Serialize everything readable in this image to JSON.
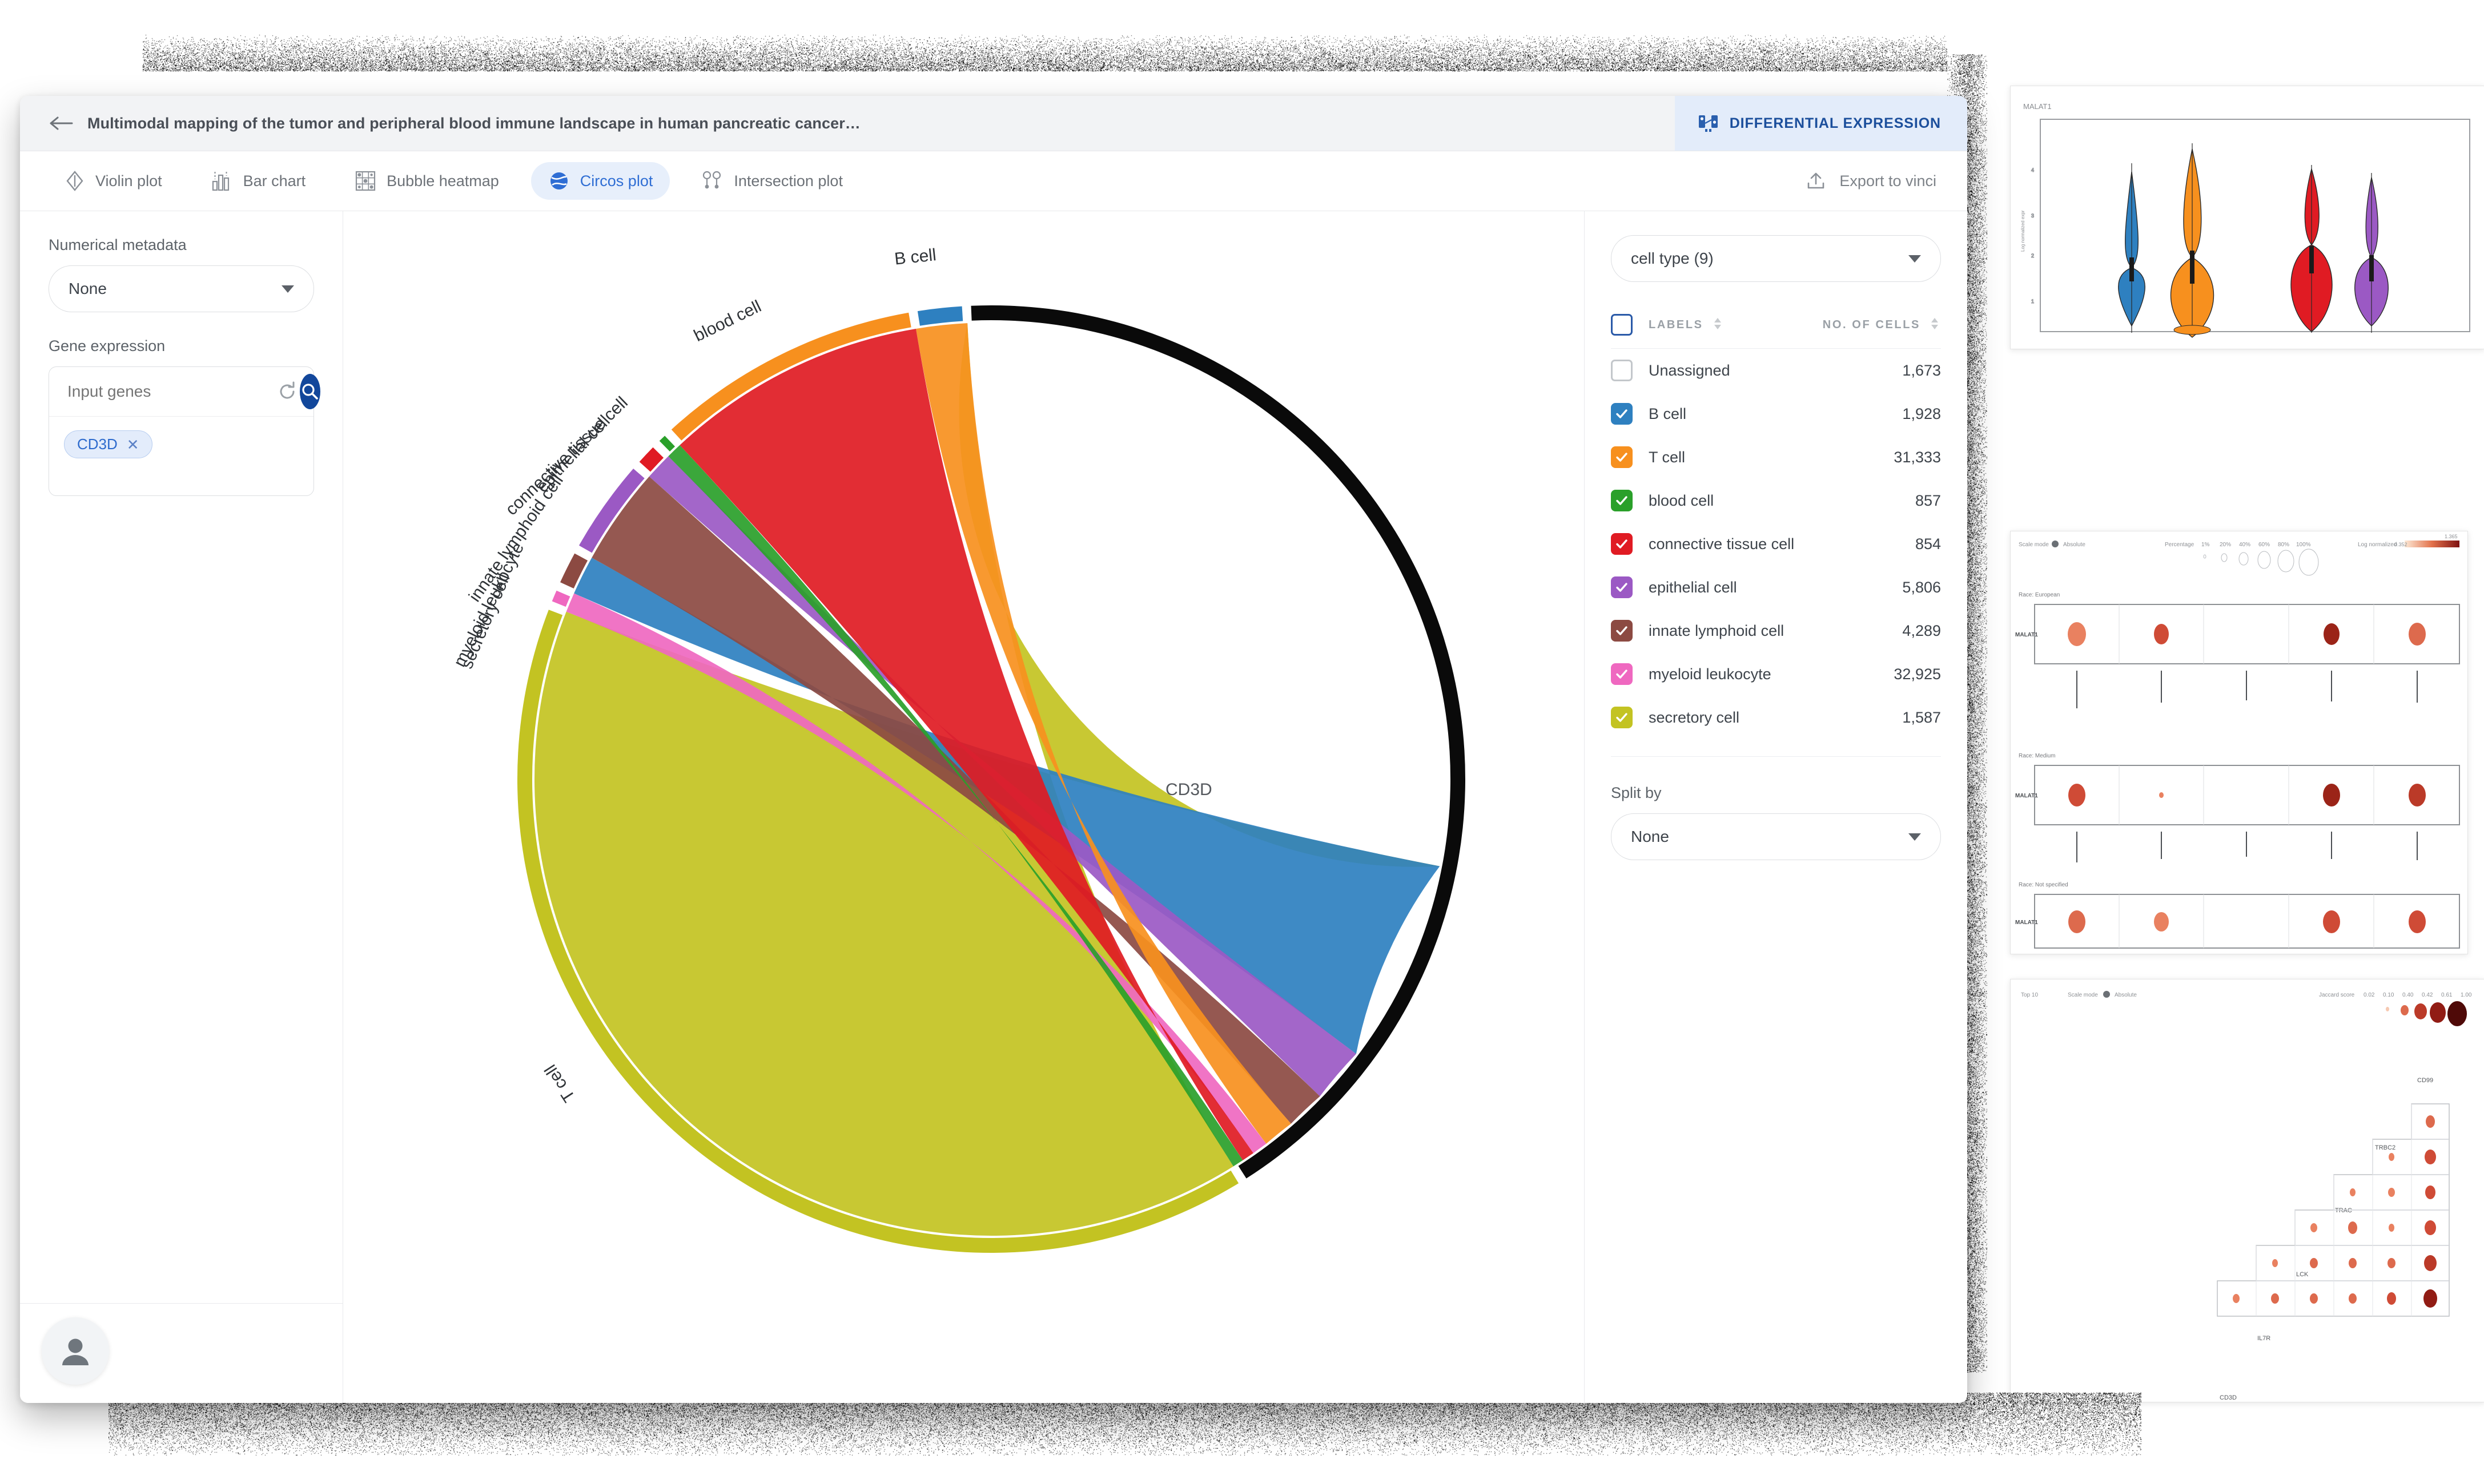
{
  "header": {
    "back_icon": "back-arrow-icon",
    "title": "Multimodal mapping of the tumor and peripheral blood immune landscape in human pancreatic cancer…",
    "differential_expression_label": "DIFFERENTIAL EXPRESSION"
  },
  "tabs": [
    {
      "label": "Violin plot",
      "icon": "violin-plot-icon",
      "active": false
    },
    {
      "label": "Bar chart",
      "icon": "bar-chart-icon",
      "active": false
    },
    {
      "label": "Bubble heatmap",
      "icon": "bubble-heatmap-icon",
      "active": false
    },
    {
      "label": "Circos plot",
      "icon": "circos-plot-icon",
      "active": true
    },
    {
      "label": "Intersection plot",
      "icon": "intersection-plot-icon",
      "active": false
    }
  ],
  "export": {
    "label": "Export to vinci",
    "icon": "upload-icon"
  },
  "left_panel": {
    "numerical_metadata_label": "Numerical metadata",
    "numerical_metadata_value": "None",
    "gene_expression_label": "Gene expression",
    "gene_input_placeholder": "Input genes",
    "gene_input_value": "",
    "refresh_icon": "refresh-icon",
    "search_icon": "search-icon",
    "chips": [
      {
        "label": "CD3D",
        "remove_icon": "close-icon"
      }
    ]
  },
  "right_panel": {
    "group_select_value": "cell type (9)",
    "col_labels": "LABELS",
    "col_count": "NO. OF CELLS",
    "split_by_label": "Split by",
    "split_by_value": "None",
    "rows": [
      {
        "label": "Unassigned",
        "count": "1,673",
        "color": "#ffffff",
        "checked": false
      },
      {
        "label": "B cell",
        "count": "1,928",
        "color": "#2e80c0",
        "checked": true
      },
      {
        "label": "T cell",
        "count": "31,333",
        "color": "#f7901e",
        "checked": true
      },
      {
        "label": "blood cell",
        "count": "857",
        "color": "#2aa02a",
        "checked": true
      },
      {
        "label": "connective tissue cell",
        "count": "854",
        "color": "#e01b23",
        "checked": true
      },
      {
        "label": "epithelial cell",
        "count": "5,806",
        "color": "#9b59c4",
        "checked": true
      },
      {
        "label": "innate lymphoid cell",
        "count": "4,289",
        "color": "#8c4a42",
        "checked": true
      },
      {
        "label": "myeloid leukocyte",
        "count": "32,925",
        "color": "#ef68c0",
        "checked": true
      },
      {
        "label": "secretory cell",
        "count": "1,587",
        "color": "#c3c322",
        "checked": true
      }
    ]
  },
  "chart_data": {
    "type": "chord",
    "title": "Circos plot",
    "gene": "CD3D",
    "segment_labels": [
      "CD3D",
      "T cell",
      "secretory cell",
      "myeloid leukocyte",
      "innate lymphoid cell",
      "epithelial cell",
      "connective tissue cell",
      "blood cell",
      "B cell"
    ],
    "segments": [
      {
        "name": "CD3D",
        "color": "#0a0a0a",
        "value": 31333,
        "start_deg": -58,
        "end_deg": 93
      },
      {
        "name": "B cell",
        "color": "#2e80c0",
        "value": 1928,
        "start_deg": 93,
        "end_deg": 99.5
      },
      {
        "name": "blood cell",
        "color": "#f7901e",
        "value": 857,
        "start_deg": 99.5,
        "end_deg": 133
      },
      {
        "name": "connective tissue cell",
        "color": "#2aa02a",
        "value": 854,
        "start_deg": 133,
        "end_deg": 135
      },
      {
        "name": "epithelial cell",
        "color": "#e01b23",
        "value": 854,
        "start_deg": 135,
        "end_deg": 138.5
      },
      {
        "name": "innate lymphoid cell",
        "color": "#9b59c4",
        "value": 5806,
        "start_deg": 138.5,
        "end_deg": 151
      },
      {
        "name": "myeloid leukocyte",
        "color": "#8c4a42",
        "value": 4289,
        "start_deg": 151,
        "end_deg": 156
      },
      {
        "name": "secretory cell",
        "color": "#ef68c0",
        "value": 1587,
        "start_deg": 156,
        "end_deg": 158.5
      },
      {
        "name": "T cell",
        "color": "#c3c322",
        "value": 31333,
        "start_deg": 158.5,
        "end_deg": 302
      }
    ],
    "chords": [
      {
        "source": "T cell",
        "target": "CD3D",
        "color": "#c3c322",
        "value": 31333
      },
      {
        "source": "myeloid leukocyte",
        "target": "CD3D",
        "color": "#2e80c0",
        "value": 32925
      },
      {
        "source": "epithelial cell",
        "target": "CD3D",
        "color": "#9b59c4",
        "value": 5806
      },
      {
        "source": "innate lymphoid cell",
        "target": "CD3D",
        "color": "#8c4a42",
        "value": 4289
      },
      {
        "source": "B cell",
        "target": "CD3D",
        "color": "#f7901e",
        "value": 1928
      },
      {
        "source": "secretory cell",
        "target": "CD3D",
        "color": "#ef68c0",
        "value": 1587
      },
      {
        "source": "blood cell",
        "target": "CD3D",
        "color": "#e01b23",
        "value": 857
      },
      {
        "source": "connective tissue cell",
        "target": "CD3D",
        "color": "#2aa02a",
        "value": 854
      }
    ]
  },
  "thumbnails": [
    {
      "name": "violin-plot-thumbnail",
      "gene": "MALAT1"
    },
    {
      "name": "bubble-heatmap-thumbnail",
      "gene": "MALAT1"
    },
    {
      "name": "intersection-plot-thumbnail",
      "gene": "CD3D"
    }
  ]
}
